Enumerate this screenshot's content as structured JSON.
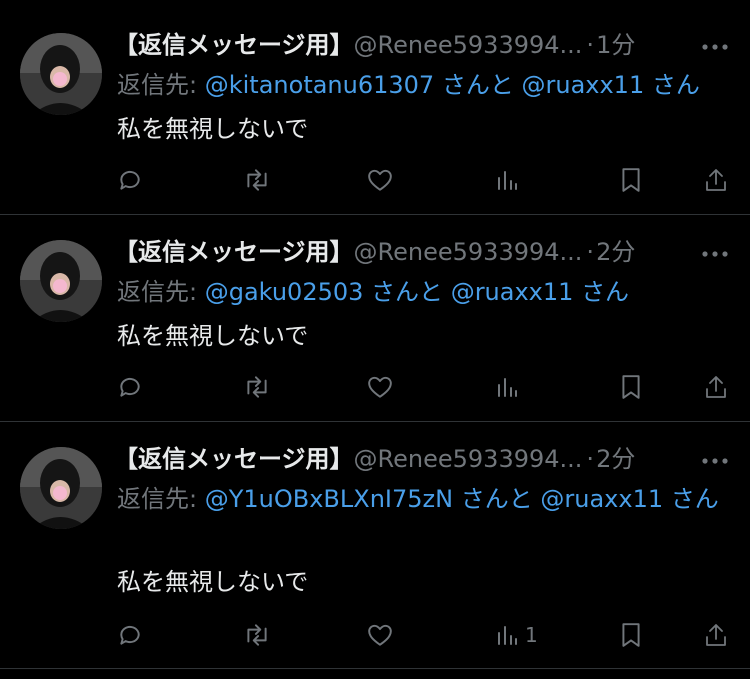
{
  "colors": {
    "background": "#000000",
    "text": "#e7e9ea",
    "muted": "#71767b",
    "link": "#4a9fe9",
    "divider": "#2f3336"
  },
  "tweets": [
    {
      "name": "【返信メッセージ用】",
      "handle": "@Renee5933994...",
      "separator": "·",
      "time": "1分",
      "reply_prefix": "返信先:",
      "mention_1": "@kitanotanu61307",
      "joiner": "さんと",
      "mention_2": "@ruaxx11",
      "suffix": "さん",
      "text": "私を無視しないで",
      "views": "",
      "icons": [
        "more-icon",
        "reply-icon",
        "retweet-icon",
        "like-icon",
        "views-icon",
        "bookmark-icon",
        "share-icon"
      ]
    },
    {
      "name": "【返信メッセージ用】",
      "handle": "@Renee5933994...",
      "separator": "·",
      "time": "2分",
      "reply_prefix": "返信先:",
      "mention_1": "@gaku02503",
      "joiner": "さんと",
      "mention_2": "@ruaxx11",
      "suffix": "さん",
      "text": "私を無視しないで",
      "views": ""
    },
    {
      "name": "【返信メッセージ用】",
      "handle": "@Renee5933994...",
      "separator": "·",
      "time": "2分",
      "reply_prefix": "返信先:",
      "mention_1": "@Y1uOBxBLXnI75zN",
      "joiner": "さんと",
      "mention_2": "@ruaxx11",
      "suffix": "さん",
      "text": "私を無視しないで",
      "views": "1"
    }
  ]
}
